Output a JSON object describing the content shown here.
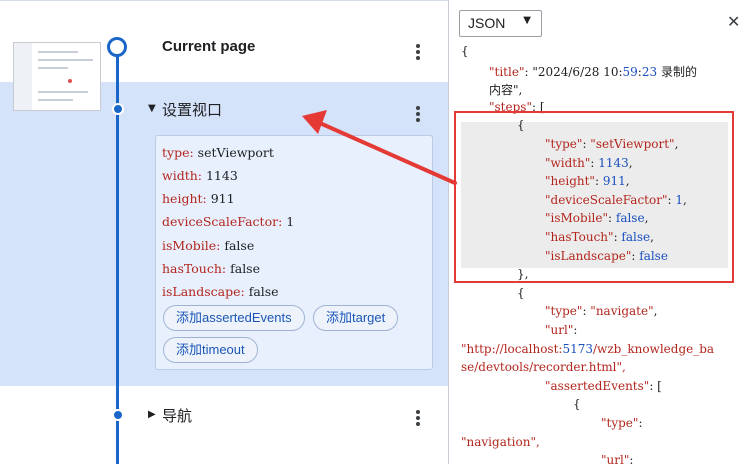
{
  "steps_panel": {
    "current": {
      "title": "Current page"
    },
    "step1": {
      "title": "设置视口",
      "properties": [
        {
          "key": "type",
          "value": "setViewport"
        },
        {
          "key": "width",
          "value": "1143"
        },
        {
          "key": "height",
          "value": "911"
        },
        {
          "key": "deviceScaleFactor",
          "value": "1"
        },
        {
          "key": "isMobile",
          "value": "false"
        },
        {
          "key": "hasTouch",
          "value": "false"
        },
        {
          "key": "isLandscape",
          "value": "false"
        }
      ],
      "buttons": {
        "add_asserted_events": "添加assertedEvents",
        "add_target": "添加target",
        "add_timeout": "添加timeout"
      }
    },
    "step2": {
      "title": "导航"
    }
  },
  "json_panel": {
    "format": "JSON",
    "lines": [
      "{",
      "\"title\": \"2024/6/28 10:59:23 录制的",
      "内容\",",
      "\"steps\": [",
      "{",
      "\"type\": \"setViewport\",",
      "\"width\": 1143,",
      "\"height\": 911,",
      "\"deviceScaleFactor\": 1,",
      "\"isMobile\": false,",
      "\"hasTouch\": false,",
      "\"isLandscape\": false",
      "},",
      "{",
      "\"type\": \"navigate\",",
      "\"url\":",
      "\"http://localhost:5173/wzb_knowledge_ba",
      "se/devtools/recorder.html\",",
      "\"assertedEvents\": [",
      "{",
      "\"type\":",
      "\"navigation\",",
      "\"url\":"
    ]
  },
  "colors": {
    "accent": "#1a66c9",
    "highlight": "#e53935"
  }
}
